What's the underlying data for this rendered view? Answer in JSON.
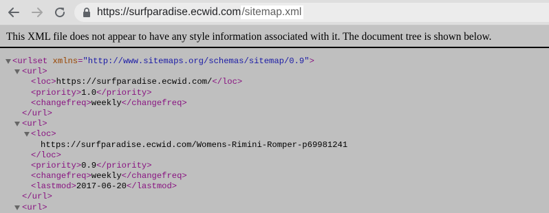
{
  "browser": {
    "url_host": "https://surfparadise.ecwid.com",
    "url_path": "/sitemap.xml"
  },
  "notice": "This XML file does not appear to have any style information associated with it. The document tree is shown below.",
  "tree": {
    "urlset_open": "<urlset",
    "urlset_attr_name": "xmlns",
    "urlset_attr_eq": "=",
    "urlset_attr_value": "\"http://www.sitemaps.org/schemas/sitemap/0.9\"",
    "urlset_close_bracket": ">",
    "url1_open": "<url>",
    "url1_loc_open": "<loc>",
    "url1_loc_value": "https://surfparadise.ecwid.com/",
    "url1_loc_close": "</loc>",
    "url1_priority_open": "<priority>",
    "url1_priority_value": "1.0",
    "url1_priority_close": "</priority>",
    "url1_changefreq_open": "<changefreq>",
    "url1_changefreq_value": "weekly",
    "url1_changefreq_close": "</changefreq>",
    "url1_close": "</url>",
    "url2_open": "<url>",
    "url2_loc_open": "<loc>",
    "url2_loc_value": "https://surfparadise.ecwid.com/Womens-Rimini-Romper-p69981241",
    "url2_loc_close": "</loc>",
    "url2_priority_open": "<priority>",
    "url2_priority_value": "0.9",
    "url2_priority_close": "</priority>",
    "url2_changefreq_open": "<changefreq>",
    "url2_changefreq_value": "weekly",
    "url2_changefreq_close": "</changefreq>",
    "url2_lastmod_open": "<lastmod>",
    "url2_lastmod_value": "2017-06-20",
    "url2_lastmod_close": "</lastmod>",
    "url2_close": "</url>",
    "url3_open": "<url>"
  }
}
